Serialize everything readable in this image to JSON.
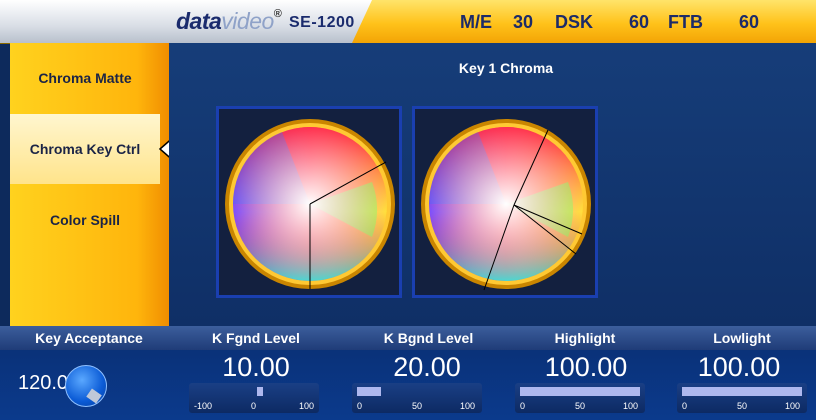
{
  "header": {
    "brand_bold": "data",
    "brand_light": "video",
    "brand_mark": "®",
    "model": "SE-1200",
    "stats": [
      {
        "label": "M/E",
        "value": ""
      },
      {
        "label": "30",
        "value": ""
      },
      {
        "label": "DSK",
        "value": ""
      },
      {
        "label": "60",
        "value": ""
      },
      {
        "label": "FTB",
        "value": ""
      },
      {
        "label": "60",
        "value": ""
      }
    ]
  },
  "sidebar": {
    "items": [
      {
        "label": "Chroma Matte"
      },
      {
        "label": "Chroma Key Ctrl",
        "active": true
      },
      {
        "label": "Color Spill"
      }
    ]
  },
  "panel": {
    "title": "Key 1 Chroma"
  },
  "controls": {
    "key_acceptance": {
      "label": "Key Acceptance",
      "value": "120.00"
    },
    "k_fgnd": {
      "label": "K Fgnd Level",
      "value": "10.00",
      "ticks": [
        "-100",
        "0",
        "100"
      ],
      "level": 0.55
    },
    "k_bgnd": {
      "label": "K Bgnd Level",
      "value": "20.00",
      "ticks": [
        "0",
        "50",
        "100"
      ],
      "level": 0.2
    },
    "highlight": {
      "label": "Highlight",
      "value": "100.00",
      "ticks": [
        "0",
        "50",
        "100"
      ],
      "level": 1.0
    },
    "lowlight": {
      "label": "Lowlight",
      "value": "100.00",
      "ticks": [
        "0",
        "50",
        "100"
      ],
      "level": 1.0
    }
  }
}
